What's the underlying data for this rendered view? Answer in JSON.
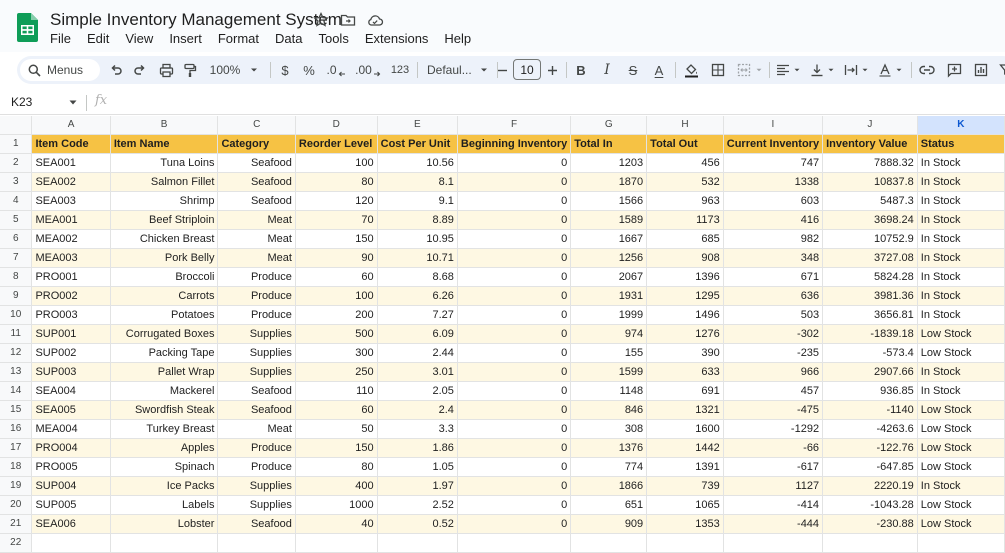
{
  "doc": {
    "title": "Simple Inventory Management System",
    "menus": [
      "File",
      "Edit",
      "View",
      "Insert",
      "Format",
      "Data",
      "Tools",
      "Extensions",
      "Help"
    ]
  },
  "toolbar": {
    "search_label": "Menus",
    "zoom": "100%",
    "currency": "$",
    "percent": "%",
    "decrease_decimal": ".0",
    "increase_decimal": ".00",
    "number_format": "123",
    "font": "Defaul...",
    "font_size": "10",
    "bold": "B",
    "italic": "I",
    "strikethrough": "S",
    "text_color": "A"
  },
  "formula_bar": {
    "cell_ref": "K23",
    "fx": "fx",
    "value": ""
  },
  "columns": [
    "A",
    "B",
    "C",
    "D",
    "E",
    "F",
    "G",
    "H",
    "I",
    "J",
    "K"
  ],
  "selected_column": "K",
  "headers": [
    "Item Code",
    "Item Name",
    "Category",
    "Reorder Level",
    "Cost Per Unit",
    "Beginning Inventory",
    "Total In",
    "Total Out",
    "Current Inventory",
    "Inventory Value",
    "Status"
  ],
  "rows": [
    [
      "SEA001",
      "Tuna Loins",
      "Seafood",
      "100",
      "10.56",
      "0",
      "1203",
      "456",
      "747",
      "7888.32",
      "In Stock"
    ],
    [
      "SEA002",
      "Salmon Fillet",
      "Seafood",
      "80",
      "8.1",
      "0",
      "1870",
      "532",
      "1338",
      "10837.8",
      "In Stock"
    ],
    [
      "SEA003",
      "Shrimp",
      "Seafood",
      "120",
      "9.1",
      "0",
      "1566",
      "963",
      "603",
      "5487.3",
      "In Stock"
    ],
    [
      "MEA001",
      "Beef Striploin",
      "Meat",
      "70",
      "8.89",
      "0",
      "1589",
      "1173",
      "416",
      "3698.24",
      "In Stock"
    ],
    [
      "MEA002",
      "Chicken Breast",
      "Meat",
      "150",
      "10.95",
      "0",
      "1667",
      "685",
      "982",
      "10752.9",
      "In Stock"
    ],
    [
      "MEA003",
      "Pork Belly",
      "Meat",
      "90",
      "10.71",
      "0",
      "1256",
      "908",
      "348",
      "3727.08",
      "In Stock"
    ],
    [
      "PRO001",
      "Broccoli",
      "Produce",
      "60",
      "8.68",
      "0",
      "2067",
      "1396",
      "671",
      "5824.28",
      "In Stock"
    ],
    [
      "PRO002",
      "Carrots",
      "Produce",
      "100",
      "6.26",
      "0",
      "1931",
      "1295",
      "636",
      "3981.36",
      "In Stock"
    ],
    [
      "PRO003",
      "Potatoes",
      "Produce",
      "200",
      "7.27",
      "0",
      "1999",
      "1496",
      "503",
      "3656.81",
      "In Stock"
    ],
    [
      "SUP001",
      "Corrugated Boxes",
      "Supplies",
      "500",
      "6.09",
      "0",
      "974",
      "1276",
      "-302",
      "-1839.18",
      "Low Stock"
    ],
    [
      "SUP002",
      "Packing Tape",
      "Supplies",
      "300",
      "2.44",
      "0",
      "155",
      "390",
      "-235",
      "-573.4",
      "Low Stock"
    ],
    [
      "SUP003",
      "Pallet Wrap",
      "Supplies",
      "250",
      "3.01",
      "0",
      "1599",
      "633",
      "966",
      "2907.66",
      "In Stock"
    ],
    [
      "SEA004",
      "Mackerel",
      "Seafood",
      "110",
      "2.05",
      "0",
      "1148",
      "691",
      "457",
      "936.85",
      "In Stock"
    ],
    [
      "SEA005",
      "Swordfish Steak",
      "Seafood",
      "60",
      "2.4",
      "0",
      "846",
      "1321",
      "-475",
      "-1140",
      "Low Stock"
    ],
    [
      "MEA004",
      "Turkey Breast",
      "Meat",
      "50",
      "3.3",
      "0",
      "308",
      "1600",
      "-1292",
      "-4263.6",
      "Low Stock"
    ],
    [
      "PRO004",
      "Apples",
      "Produce",
      "150",
      "1.86",
      "0",
      "1376",
      "1442",
      "-66",
      "-122.76",
      "Low Stock"
    ],
    [
      "PRO005",
      "Spinach",
      "Produce",
      "80",
      "1.05",
      "0",
      "774",
      "1391",
      "-617",
      "-647.85",
      "Low Stock"
    ],
    [
      "SUP004",
      "Ice Packs",
      "Supplies",
      "400",
      "1.97",
      "0",
      "1866",
      "739",
      "1127",
      "2220.19",
      "In Stock"
    ],
    [
      "SUP005",
      "Labels",
      "Supplies",
      "1000",
      "2.52",
      "0",
      "651",
      "1065",
      "-414",
      "-1043.28",
      "Low Stock"
    ],
    [
      "SEA006",
      "Lobster",
      "Seafood",
      "40",
      "0.52",
      "0",
      "909",
      "1353",
      "-444",
      "-230.88",
      "Low Stock"
    ]
  ],
  "extra_row_numbers": [
    "22"
  ],
  "colors": {
    "header_fill": "#f6c244",
    "band_fill": "#fef8e3",
    "selected_col": "#d3e3fd"
  }
}
